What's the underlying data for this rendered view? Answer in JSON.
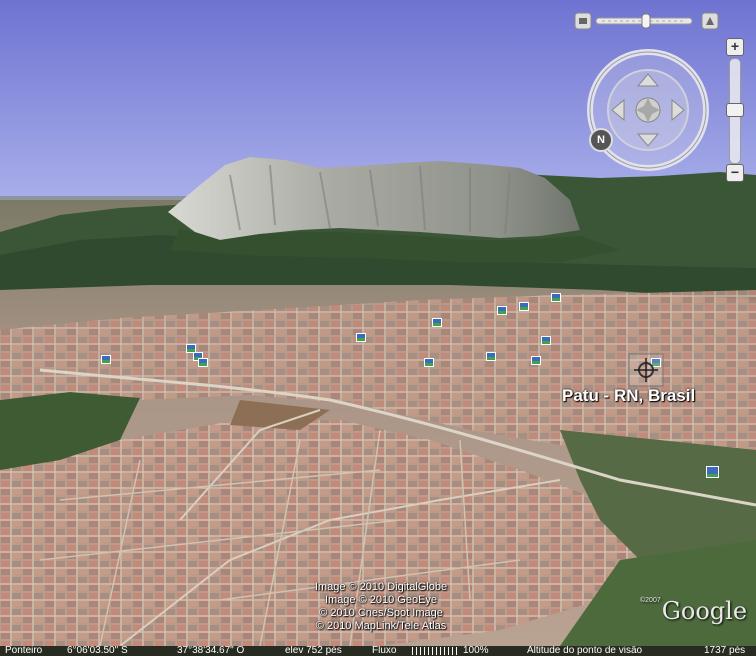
{
  "map": {
    "place_label": "Patu - RN, Brasil",
    "copyright_lines": [
      "Image © 2010 DigitalGlobe",
      "Image © 2010 GeoEye",
      "© 2010 Cnes/Spot Image",
      "© 2010 MapLink/Tele Atlas"
    ],
    "logo_small": "©2007",
    "logo": "Google"
  },
  "controls": {
    "zoom_in_label": "+",
    "zoom_out_label": "−",
    "compass_north_label": "N"
  },
  "status": {
    "pointer_label": "Ponteiro",
    "latitude": "6°06'03.50\" S",
    "longitude": "37°38'34.67\" O",
    "elevation": "elev   752 pés",
    "stream_label": "Fluxo",
    "stream_value": "100%",
    "altitude_label": "Altitude do ponto de visão",
    "altitude_value": "1737 pés"
  },
  "colors": {
    "sky_top": "#6f74d2",
    "sky_bottom": "#a9aee8",
    "vegetation": "#3d5a3a",
    "rock": "#b7b8b0",
    "urban": "#b59a8a"
  },
  "icons": [
    "zoom-slider-icon",
    "tilt-icon",
    "look-joystick-icon",
    "compass-ring-icon",
    "zoom-in-icon",
    "zoom-out-icon",
    "placemark-icon",
    "photo-marker-icon"
  ]
}
